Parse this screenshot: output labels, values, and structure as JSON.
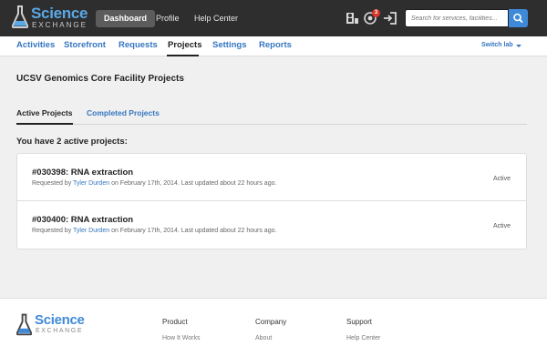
{
  "header": {
    "logo_word1": "Science",
    "logo_word2": "EXCHANGE",
    "nav": {
      "dashboard": "Dashboard",
      "profile": "Profile",
      "help_center": "Help Center"
    },
    "notification_count": "3",
    "search": {
      "placeholder": "Search for services, facilities...",
      "value": ""
    },
    "icons": [
      "user-switch-icon",
      "notification-bell-icon",
      "logout-icon",
      "search-icon"
    ]
  },
  "subnav": {
    "items": [
      {
        "label": "Activities"
      },
      {
        "label": "Storefront"
      },
      {
        "label": "Requests"
      },
      {
        "label": "Projects",
        "active": true
      },
      {
        "label": "Settings"
      },
      {
        "label": "Reports"
      }
    ],
    "switch_lab": "Switch lab"
  },
  "main": {
    "title": "UCSV Genomics Core Facility Projects",
    "tabs": [
      {
        "label": "Active Projects",
        "active": true
      },
      {
        "label": "Completed Projects"
      }
    ],
    "active_count_text": "You have 2 active projects:",
    "projects": [
      {
        "title": "#030398: RNA extraction",
        "requested_prefix": "Requested by",
        "requester": "Tyler Durden",
        "date_text": "on February 17th, 2014. Last updated about 22 hours ago.",
        "status": "Active"
      },
      {
        "title": "#030400: RNA extraction",
        "requested_prefix": "Requested by",
        "requester": "Tyler Durden",
        "date_text": "on February 17th, 2014. Last updated about 22 hours ago.",
        "status": "Active"
      }
    ]
  },
  "footer": {
    "logo_word1": "Science",
    "logo_word2": "EXCHANGE",
    "columns": [
      {
        "title": "Product",
        "link": "How It Works"
      },
      {
        "title": "Company",
        "link": "About"
      },
      {
        "title": "Support",
        "link": "Help Center"
      }
    ]
  },
  "colors": {
    "topbar_bg": "#2e2e2e",
    "accent_blue": "#3576c0",
    "search_button": "#3f8ad8",
    "badge_red": "#d9372b"
  }
}
